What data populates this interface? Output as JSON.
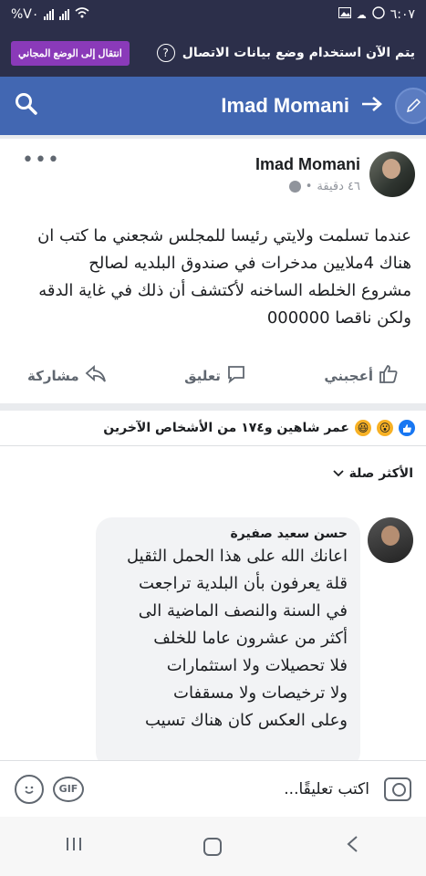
{
  "status_bar": {
    "time": "٦:٠٧",
    "battery": "%V٠"
  },
  "data_banner": {
    "text": "يتم الآن استخدام وضع بيانات الاتصال",
    "help_symbol": "?",
    "free_mode_button": "انتقال إلى الوضع المجاني"
  },
  "header": {
    "title": "Imad Momani"
  },
  "post": {
    "author": "Imad Momani",
    "time": "٤٦ دقيقة",
    "more": "•••",
    "text_lines": [
      "عندما تسلمت ولايتي رئيسا للمجلس شجعني ما كتب ان",
      "هناك 4ملايين مدخرات في صندوق البلديه لصالح",
      "مشروع الخلطه الساخنه لأكتشف أن ذلك في غاية الدقه",
      "ولكن ناقصا 000000"
    ],
    "actions": {
      "like": "أعجبني",
      "comment": "تعليق",
      "share": "مشاركة"
    }
  },
  "reactions": {
    "text": "عمر شاهين و١٧٤ من الأشخاص الآخرين"
  },
  "comments": {
    "sort_label": "الأكثر صلة",
    "items": [
      {
        "name": "حسن سعيد صفيرة",
        "lines": [
          "اعانك الله على هذا الحمل الثقيل",
          "قلة  يعرفون بأن البلدية تراجعت",
          "في السنة والنصف الماضية الى",
          "أكثر من عشرون عاما للخلف",
          "فلا تحصيلات ولا استثمارات",
          "ولا ترخيصات ولا مسقفات",
          "وعلى العكس كان هناك تسيب"
        ]
      }
    ]
  },
  "comment_bar": {
    "placeholder": "اكتب تعليقًا...",
    "gif_label": "GIF"
  },
  "icons": {
    "search": "search-icon",
    "pen": "pen-icon",
    "globe": "globe-icon",
    "like": "like-icon",
    "comment": "comment-icon",
    "share": "share-icon",
    "emoji": "emoji-icon",
    "camera": "camera-icon"
  },
  "colors": {
    "facebook_blue": "#4267b2",
    "banner_dark": "#2c2f4a",
    "free_mode_purple": "#8a3ab9"
  }
}
